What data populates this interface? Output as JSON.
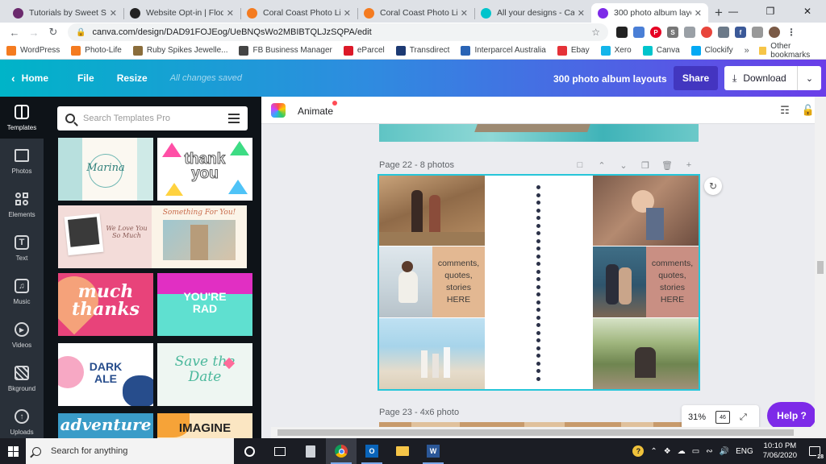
{
  "browser": {
    "tabs": [
      {
        "title": "Tutorials by Sweet Shop",
        "icon": "sweetshop-icon",
        "color": "#6b2a6d"
      },
      {
        "title": "Website Opt-in | Flodesk",
        "icon": "flodesk-icon",
        "color": "#222222"
      },
      {
        "title": "Coral Coast Photo Life",
        "icon": "star-burst-icon",
        "color": "#f47b20"
      },
      {
        "title": "Coral Coast Photo Life",
        "icon": "star-burst-icon",
        "color": "#f47b20"
      },
      {
        "title": "All your designs - Canva",
        "icon": "canva-icon",
        "color": "#00c4cc"
      },
      {
        "title": "300 photo album layouts",
        "icon": "canva-icon",
        "color": "#7d2ae8",
        "active": true
      }
    ],
    "url": "canva.com/design/DAD91FOJEog/UeBNQsWo2MBIBTQLJzSQPA/edit",
    "bookmarks": [
      {
        "label": "WordPress",
        "color": "#f47b20"
      },
      {
        "label": "Photo-Life",
        "color": "#f47b20"
      },
      {
        "label": "Ruby Spikes Jewelle...",
        "color": "#8a6d3b"
      },
      {
        "label": "FB Business Manager",
        "color": "#444444"
      },
      {
        "label": "eParcel",
        "color": "#dc1928"
      },
      {
        "label": "Transdirect",
        "color": "#1d3a73"
      },
      {
        "label": "Interparcel Australia",
        "color": "#2a64b5"
      },
      {
        "label": "Ebay",
        "color": "#e53238"
      },
      {
        "label": "Xero",
        "color": "#13b5ea"
      },
      {
        "label": "Canva",
        "color": "#00c4cc"
      },
      {
        "label": "Clockify",
        "color": "#03a9f4"
      }
    ],
    "bookmarks_more": "»",
    "other_bookmarks": "Other bookmarks"
  },
  "canva": {
    "home": "Home",
    "file": "File",
    "resize": "Resize",
    "saved": "All changes saved",
    "design_title": "300 photo album layouts",
    "share": "Share",
    "download": "Download",
    "accent": "#7d2ae8"
  },
  "rail": [
    {
      "label": "Templates",
      "icon": "templates-icon",
      "active": true
    },
    {
      "label": "Photos",
      "icon": "photos-icon"
    },
    {
      "label": "Elements",
      "icon": "elements-icon"
    },
    {
      "label": "Text",
      "icon": "text-icon"
    },
    {
      "label": "Music",
      "icon": "music-icon"
    },
    {
      "label": "Videos",
      "icon": "videos-icon"
    },
    {
      "label": "Bkground",
      "icon": "background-icon"
    },
    {
      "label": "Uploads",
      "icon": "uploads-icon"
    }
  ],
  "templates": {
    "search_placeholder": "Search Templates Pro",
    "thumbs": [
      {
        "text": "Marina"
      },
      {
        "text": "thank you"
      },
      {
        "text": "We Love You So Much"
      },
      {
        "text": "Something For You!"
      },
      {
        "text": "much thanks"
      },
      {
        "text": "YOU'RE RAD"
      },
      {
        "text": "DARK ALE"
      },
      {
        "text": "Save the Date"
      },
      {
        "text": "adventure"
      },
      {
        "text": "IMAGINE"
      }
    ]
  },
  "editor": {
    "animate": "Animate",
    "page_label": "Page 22 - 8 photos",
    "next_page_label": "Page 23 - 4x6 photo",
    "textbox": [
      "comments,",
      "quotes,",
      "stories",
      "HERE"
    ],
    "zoom": "31%",
    "page_count": "46",
    "help": "Help ?"
  },
  "taskbar": {
    "search_placeholder": "Search for anything",
    "language": "ENG",
    "time": "10:10 PM",
    "date": "7/06/2020",
    "notifications": "28"
  }
}
